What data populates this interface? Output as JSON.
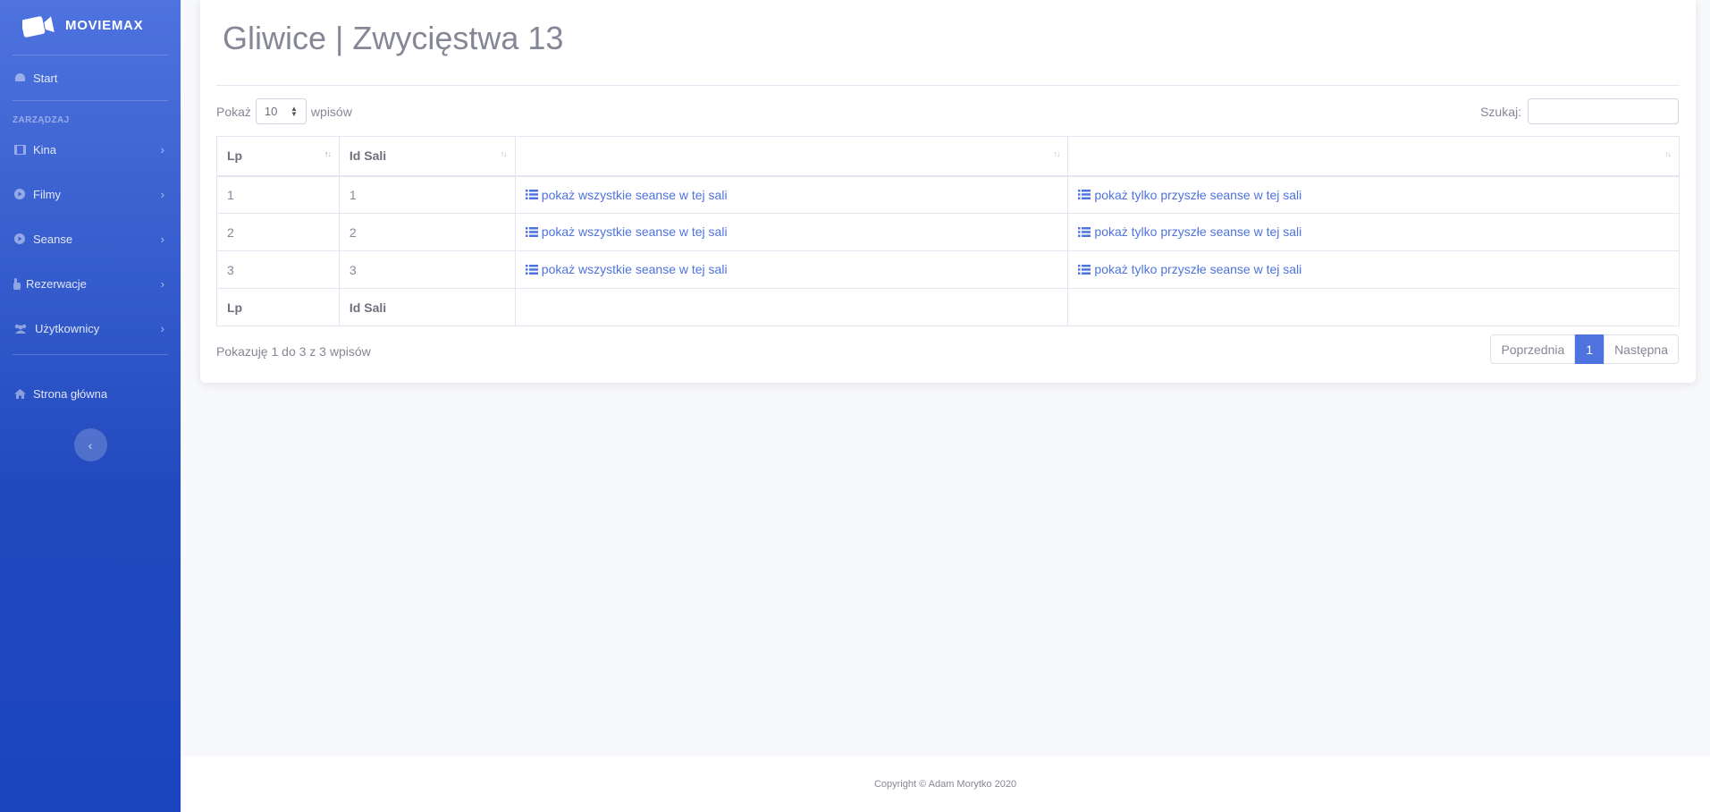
{
  "sidebar": {
    "brand": "MOVIEMAX",
    "start": "Start",
    "heading": "ZARZĄDZAJ",
    "items": [
      {
        "label": "Kina",
        "icon": "film-icon"
      },
      {
        "label": "Filmy",
        "icon": "play-circle-icon"
      },
      {
        "label": "Seanse",
        "icon": "play-circle-icon"
      },
      {
        "label": "Rezerwacje",
        "icon": "hand-pointer-icon"
      },
      {
        "label": "Użytkownicy",
        "icon": "users-icon"
      }
    ],
    "home": "Strona główna",
    "collapse": "‹"
  },
  "page": {
    "title": "Gliwice | Zwycięstwa 13"
  },
  "table_controls": {
    "show_prefix": "Pokaż",
    "page_length": "10",
    "show_suffix": "wpisów",
    "search_label": "Szukaj:",
    "search_value": ""
  },
  "table": {
    "headers": [
      "Lp",
      "Id Sali",
      "",
      ""
    ],
    "rows": [
      {
        "lp": "1",
        "id": "1",
        "all": "pokaż wszystkie seanse w tej sali",
        "future": "pokaż tylko przyszłe seanse w tej sali"
      },
      {
        "lp": "2",
        "id": "2",
        "all": "pokaż wszystkie seanse w tej sali",
        "future": "pokaż tylko przyszłe seanse w tej sali"
      },
      {
        "lp": "3",
        "id": "3",
        "all": "pokaż wszystkie seanse w tej sali",
        "future": "pokaż tylko przyszłe seanse w tej sali"
      }
    ],
    "footers": [
      "Lp",
      "Id Sali",
      "",
      ""
    ]
  },
  "info": "Pokazuję 1 do 3 z 3 wpisów",
  "pagination": {
    "prev": "Poprzednia",
    "current": "1",
    "next": "Następna"
  },
  "footer": "Copyright © Adam Morytko 2020",
  "colors": {
    "primary": "#4e73df",
    "sidebar_dark": "#224abe",
    "text": "#858796"
  }
}
